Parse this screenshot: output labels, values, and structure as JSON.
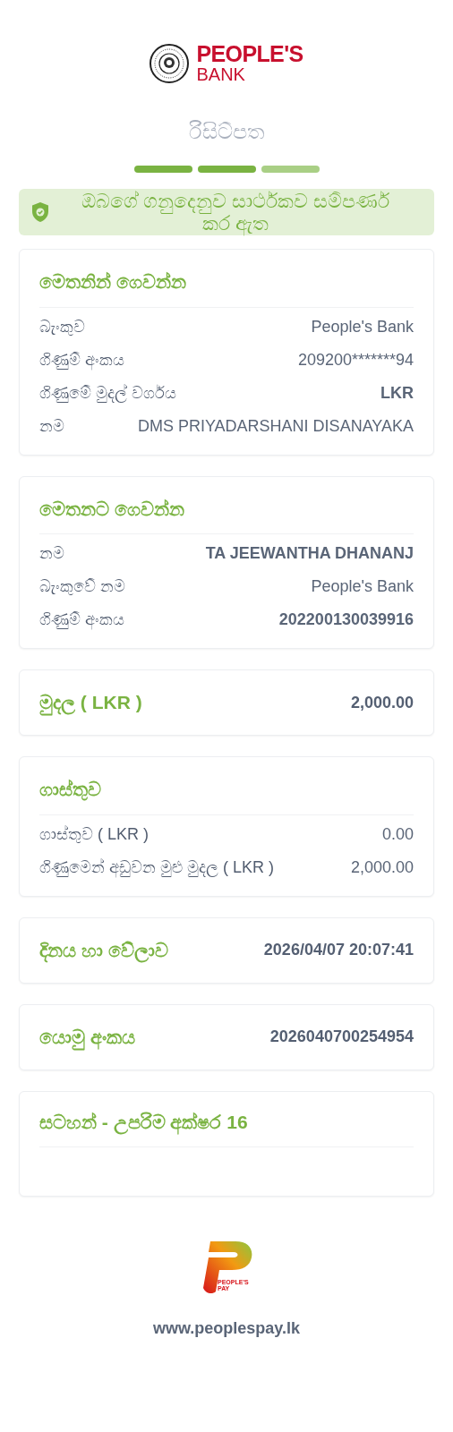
{
  "logo": {
    "line_1": "PEOPLE'S",
    "line_2": "BANK"
  },
  "title": "රිසිට්පත",
  "steps": [
    {
      "done": true
    },
    {
      "done": true
    },
    {
      "done": false
    }
  ],
  "banner": {
    "text": "ඔබගේ ගනුදෙනුව සාර්ථකව සම්පර්ණ කර ඇත"
  },
  "sections": [
    {
      "kind": "list",
      "title": "මෙතනින් ගෙවන්න",
      "rows": [
        {
          "label": "බැංකුව",
          "value": "People's Bank",
          "bold": false
        },
        {
          "label": "ගිණුම් අංකය",
          "value": "209200*******94",
          "bold": false
        },
        {
          "label": "ගිණුමේ මුදල් වර්ගය",
          "value": "LKR",
          "bold": true
        },
        {
          "label": "නම",
          "value": "DMS PRIYADARSHANI DISANAYAKA",
          "bold": false
        }
      ]
    },
    {
      "kind": "list",
      "title": "මෙතනට ගෙවන්න",
      "rows": [
        {
          "label": "නම",
          "value": "TA JEEWANTHA DHANANJ",
          "bold": true
        },
        {
          "label": "බැංකුවේ නම",
          "value": "People's Bank",
          "bold": false
        },
        {
          "label": "ගිණුම් අංකය",
          "value": "202200130039916",
          "bold": true
        }
      ]
    },
    {
      "kind": "single",
      "title": "මුදල ( LKR )",
      "value": "2,000.00"
    },
    {
      "kind": "list",
      "title": "ගාස්තුව",
      "rows": [
        {
          "label": "ගාස්තුව ( LKR )",
          "value": "0.00",
          "bold": false
        },
        {
          "label": "ගිණුමෙන් අඩුවන මුළු මුදල ( LKR )",
          "value": "2,000.00",
          "bold": false
        }
      ]
    },
    {
      "kind": "single",
      "title": "දිනය හා වේලාව",
      "value": "2026/04/07 20:07:41"
    },
    {
      "kind": "single",
      "title": "යොමු අංකය",
      "value": "2026040700254954"
    },
    {
      "kind": "note",
      "title": "සටහන් - උපරිම අක්ෂර 16"
    }
  ],
  "footer": {
    "logo_line_1": "PEOPLE'S",
    "logo_line_2": "PAY",
    "url": "www.peoplespay.lk"
  }
}
